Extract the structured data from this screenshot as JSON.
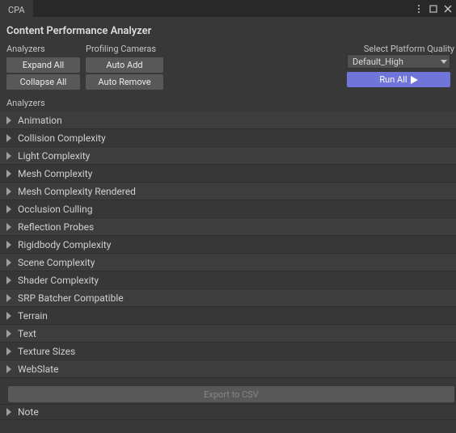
{
  "tab_title": "CPA",
  "panel_title": "Content Performance Analyzer",
  "sections": {
    "analyzers_label": "Analyzers",
    "profiling_label": "Profiling Cameras",
    "platform_label": "Select Platform Quality",
    "list_label": "Analyzers",
    "note_label": "Note"
  },
  "buttons": {
    "expand_all": "Expand All",
    "collapse_all": "Collapse All",
    "auto_add": "Auto Add",
    "auto_remove": "Auto Remove",
    "run_all": "Run All",
    "export_csv": "Export to CSV"
  },
  "platform_dropdown": {
    "selected": "Default_High"
  },
  "analyzers": [
    {
      "label": "Animation"
    },
    {
      "label": "Collision Complexity"
    },
    {
      "label": "Light Complexity"
    },
    {
      "label": "Mesh Complexity"
    },
    {
      "label": "Mesh Complexity Rendered"
    },
    {
      "label": "Occlusion Culling"
    },
    {
      "label": "Reflection Probes"
    },
    {
      "label": "Rigidbody Complexity"
    },
    {
      "label": "Scene Complexity"
    },
    {
      "label": "Shader Complexity"
    },
    {
      "label": "SRP Batcher Compatible"
    },
    {
      "label": "Terrain"
    },
    {
      "label": "Text"
    },
    {
      "label": "Texture Sizes"
    },
    {
      "label": "WebSlate"
    }
  ]
}
